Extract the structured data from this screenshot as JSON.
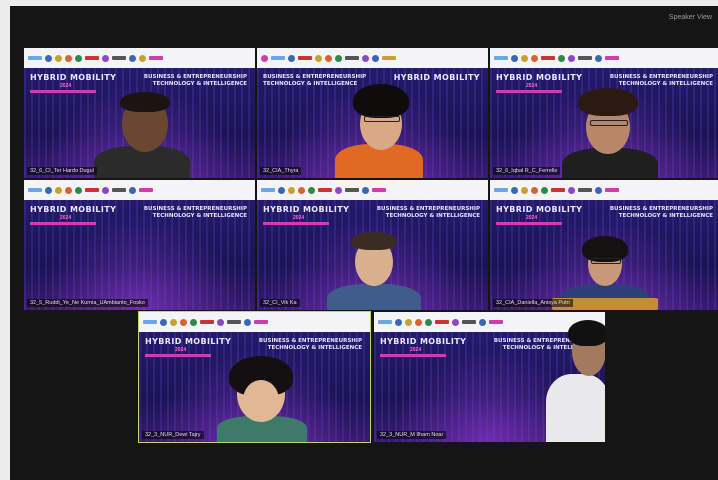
{
  "window": {
    "top_label": "Speaker View"
  },
  "event": {
    "title": "HYBRID MOBILITY",
    "year_text": "2024",
    "theme_line1": "BUSINESS & ENTREPRENEURSHIP",
    "theme_line2": "TECHNOLOGY & INTELLIGENCE"
  },
  "participants": [
    {
      "name": "32_6_CI_Ter Hardo Dugul",
      "active": false
    },
    {
      "name": "32_CIA_Thyra",
      "active": false
    },
    {
      "name": "32_6_Iqbal R_C_Ferrelle",
      "active": false
    },
    {
      "name": "32_5_Ruddi_Ye_Ne Kurnia_UAmbianto_Fosko",
      "active": false
    },
    {
      "name": "32_CI_Vik Ka",
      "active": false
    },
    {
      "name": "32_CIA_Daniella_Anisya Putri",
      "active": false
    },
    {
      "name": "32_3_NUR_Dewi Tajry",
      "active": true
    },
    {
      "name": "32_3_NUR_M Ilham Noar",
      "active": false
    }
  ],
  "colors": {
    "accent_active": "#b9d870",
    "banner_pink": "#d13cb0"
  }
}
